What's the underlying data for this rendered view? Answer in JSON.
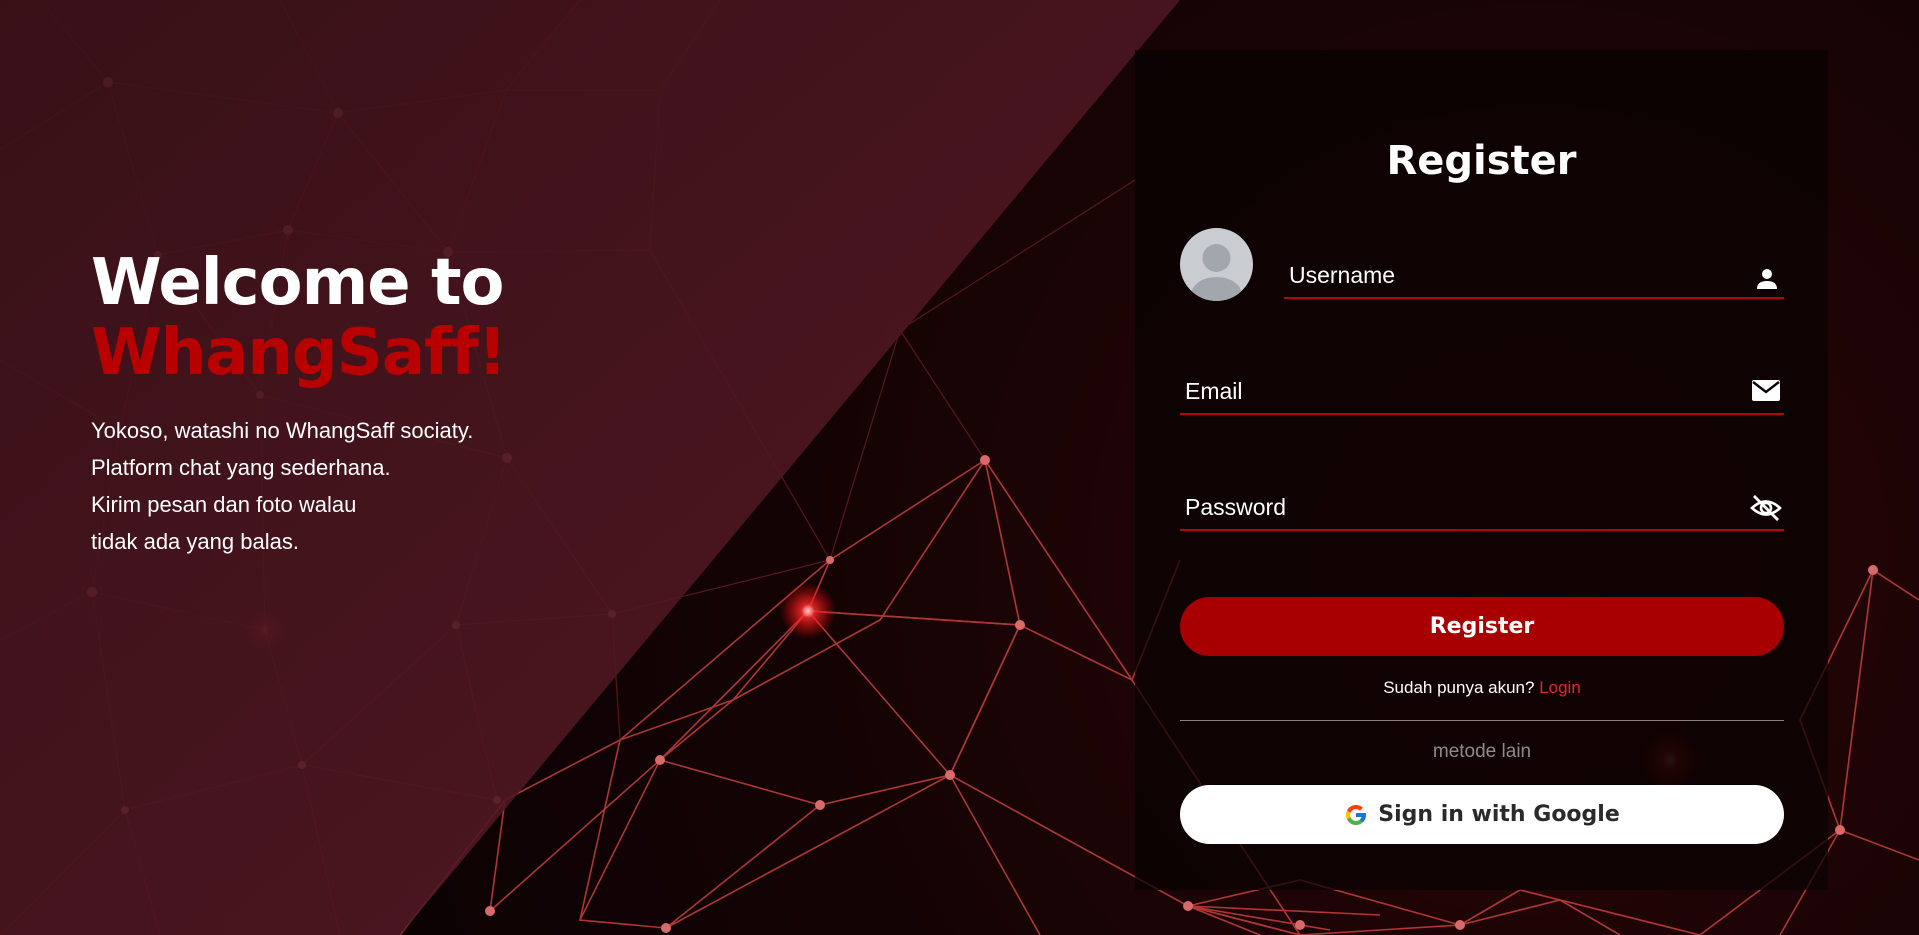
{
  "hero": {
    "welcome": "Welcome to",
    "brand": "WhangSaff!",
    "lines": [
      "Yokoso, watashi no WhangSaff sociaty.",
      "Platform chat yang sederhana.",
      "Kirim pesan dan foto walau",
      "tidak ada yang balas."
    ]
  },
  "form": {
    "title": "Register",
    "username_placeholder": "Username",
    "email_placeholder": "Email",
    "password_placeholder": "Password",
    "register_label": "Register",
    "have_account": "Sudah punya akun?",
    "login_link": "Login",
    "other_methods": "metode lain",
    "google_label": "Sign in with Google"
  },
  "icons": {
    "avatar": "default-avatar-icon",
    "username": "user-icon",
    "email": "envelope-icon",
    "password": "eye-slash-icon",
    "google": "google-g-icon"
  },
  "colors": {
    "accent": "#b80000",
    "button": "#a80000",
    "link": "#e0282c",
    "left_panel": "#4a1520"
  }
}
